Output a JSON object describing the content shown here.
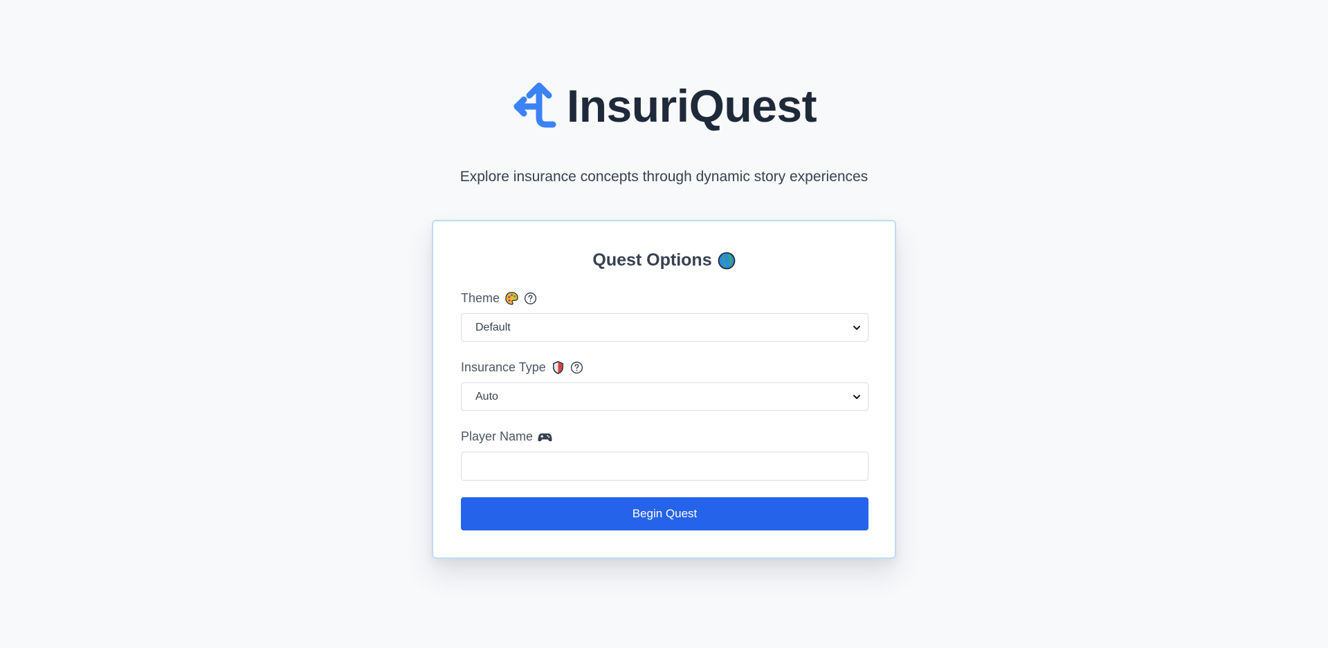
{
  "brand": {
    "title": "InsuriQuest",
    "tagline": "Explore insurance concepts through dynamic story experiences",
    "logo_icon": "split-arrow-icon",
    "accent_color": "#3b82f6"
  },
  "card": {
    "title": "Quest Options",
    "title_icon": "globe-icon",
    "fields": {
      "theme": {
        "label": "Theme",
        "icon": "palette-icon",
        "help_icon": "help-circle-icon",
        "selected": "Default"
      },
      "insurance_type": {
        "label": "Insurance Type",
        "icon": "shield-icon",
        "help_icon": "help-circle-icon",
        "selected": "Auto"
      },
      "player_name": {
        "label": "Player Name",
        "icon": "gamepad-icon",
        "value": "",
        "placeholder": ""
      }
    },
    "submit_label": "Begin Quest",
    "button_color": "#2563eb"
  }
}
